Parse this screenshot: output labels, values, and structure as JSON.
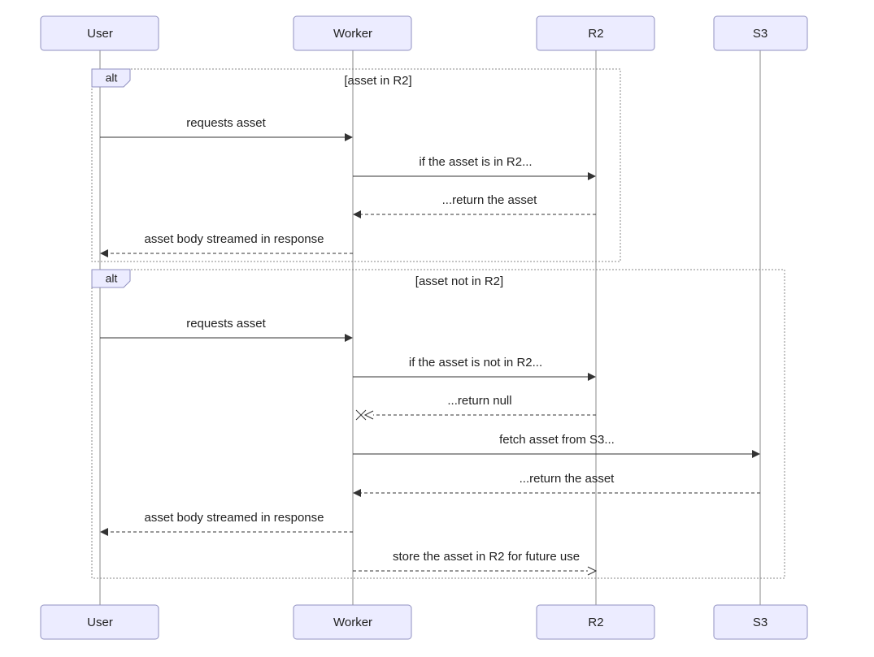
{
  "actors": {
    "user": "User",
    "worker": "Worker",
    "r2": "R2",
    "s3": "S3"
  },
  "alt1": {
    "label": "alt",
    "condition": "[asset in R2]",
    "messages": {
      "m1": "requests asset",
      "m2": "if the asset is in R2...",
      "m3": "...return the asset",
      "m4": "asset body streamed in response"
    }
  },
  "alt2": {
    "label": "alt",
    "condition": "[asset not in R2]",
    "messages": {
      "m1": "requests asset",
      "m2": "if the asset is not in R2...",
      "m3": "...return null",
      "m4": "fetch asset from S3...",
      "m5": "...return the asset",
      "m6": "asset body streamed in response",
      "m7": "store the asset in R2 for future use"
    }
  }
}
